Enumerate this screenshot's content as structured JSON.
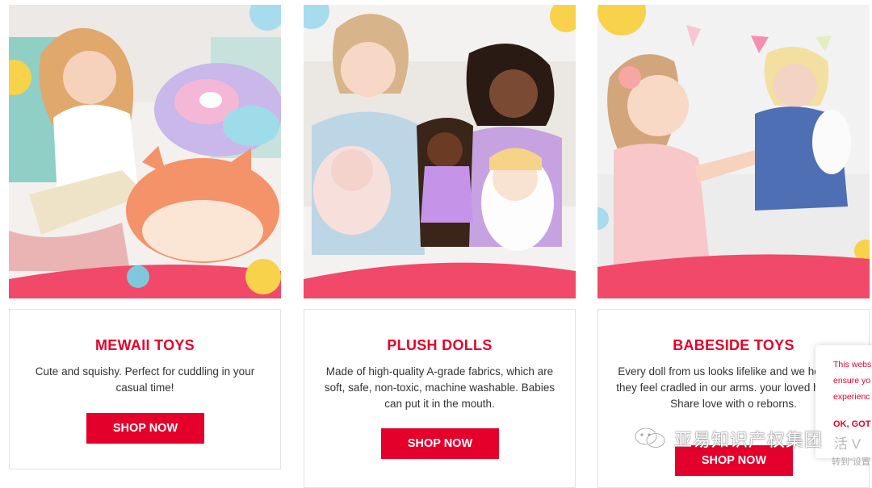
{
  "cards": [
    {
      "title": "MEWAII TOYS",
      "description": "Cute and squishy. Perfect for cuddling in your casual time!",
      "button": "SHOP NOW"
    },
    {
      "title": "PLUSH DOLLS",
      "description": "Made of high-quality A-grade fabrics, which are soft, safe, non-toxic, machine washable. Babies can put it in the mouth.",
      "button": "SHOP NOW"
    },
    {
      "title": "BABESIDE TOYS",
      "description": "Every doll from us looks lifelike and we how real they feel cradled in our arms. your loved home & Share love with o reborns.",
      "button": "SHOP NOW"
    }
  ],
  "cookie_banner": {
    "text": "This webs\nensure yo\nexperienc",
    "accept": "OK, GOT"
  },
  "watermark": {
    "name": "亚易知识产权集团",
    "activate": "活 V",
    "goto": "转到\"设置"
  },
  "colors": {
    "accent": "#e4002b",
    "photo_band": "#f0496a"
  },
  "icons": [
    "wechat-logo-icon"
  ]
}
